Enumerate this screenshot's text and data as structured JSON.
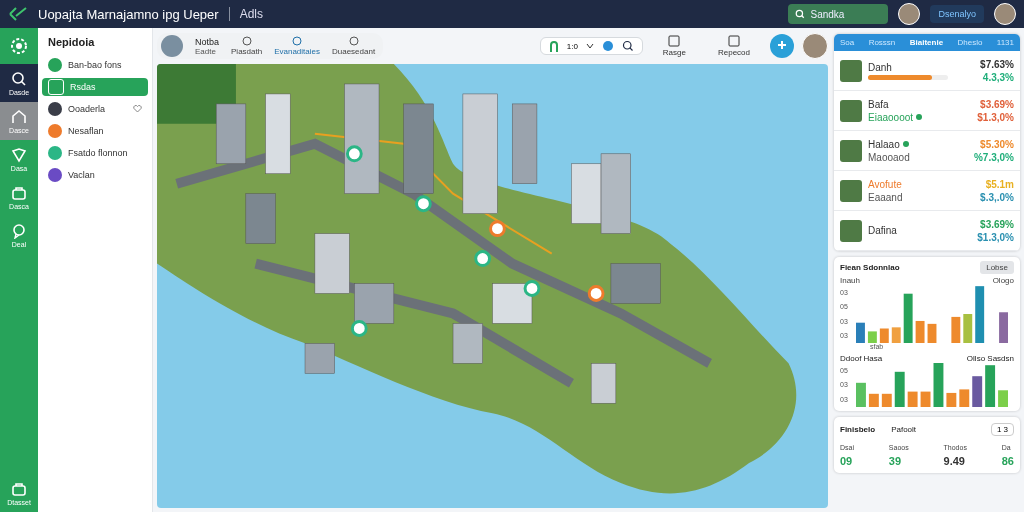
{
  "header": {
    "title": "Uopajta Marnajamno ipg Ueper",
    "subtitle": "Adls",
    "search": {
      "placeholder": "Sandka"
    },
    "user_button": "Dsenalyo"
  },
  "rail": {
    "items": [
      {
        "label": "Dasde",
        "kind": "search",
        "selected": true,
        "highlighted": false
      },
      {
        "label": "Dasce",
        "kind": "home",
        "selected": false,
        "highlighted": true
      },
      {
        "label": "Dasa",
        "kind": "shield",
        "selected": false,
        "highlighted": false
      },
      {
        "label": "Dasca",
        "kind": "bag",
        "selected": false,
        "highlighted": false
      },
      {
        "label": "Deal",
        "kind": "chat",
        "selected": false,
        "highlighted": false
      }
    ],
    "bottom": "Dtasset"
  },
  "sidebar": {
    "heading": "Nepidoia",
    "items": [
      {
        "label": "Ban-bao fons",
        "color": "#27a35a",
        "selected": false,
        "badge": false
      },
      {
        "label": "Rsdas",
        "color": "#27a35a",
        "selected": true,
        "badge": false
      },
      {
        "label": "Ooaderla",
        "color": "#3a3d48",
        "selected": false,
        "badge": true
      },
      {
        "label": "Nesaflan",
        "color": "#ee7b2c",
        "selected": false,
        "badge": false
      },
      {
        "label": "Fsatdo flonnon",
        "color": "#2bb686",
        "selected": false,
        "badge": false
      },
      {
        "label": "Vaclan",
        "color": "#6a4bc4",
        "selected": false,
        "badge": false
      }
    ]
  },
  "toolbar": {
    "profile": {
      "name": "Notba",
      "sub": "Eadte"
    },
    "tabs": [
      {
        "label": "Piasdath",
        "selected": false
      },
      {
        "label": "Evanaditaies",
        "selected": true
      },
      {
        "label": "Duaesedant",
        "selected": false
      }
    ],
    "control_value": "1:0",
    "actions": [
      {
        "label": "Rasge"
      },
      {
        "label": "Repecod"
      }
    ]
  },
  "panel": {
    "tabs": [
      {
        "label": "Soa",
        "selected": false
      },
      {
        "label": "Rosssn",
        "selected": false
      },
      {
        "label": "Biaitenie",
        "selected": true
      },
      {
        "label": "Dheslo",
        "selected": false
      },
      {
        "label": "1131",
        "selected": false
      }
    ],
    "rows": [
      {
        "name": {
          "text": "Danh",
          "color": "#333333"
        },
        "sub": null,
        "dot": false,
        "level": 0.8,
        "value": {
          "text": "$7.63%",
          "color": "#333333"
        },
        "change": {
          "text": "4.3,3%",
          "color": "#1fae7a"
        }
      },
      {
        "name": {
          "text": "Bafa",
          "color": "#333333"
        },
        "sub": {
          "text": "Eiaaoooot",
          "color": "#27a35a"
        },
        "dot": false,
        "sub_dot": true,
        "value": {
          "text": "$3.69%",
          "color": "#e0603a"
        },
        "change": {
          "text": "$1.3,0%",
          "color": "#e0603a"
        }
      },
      {
        "name": {
          "text": "Halaao",
          "color": "#333333"
        },
        "sub": {
          "text": "Maooaod",
          "color": "#555555"
        },
        "dot": true,
        "value": {
          "text": "$5.30%",
          "color": "#ee8a2c"
        },
        "change": {
          "text": "%7.3,0%",
          "color": "#1fae7a"
        }
      },
      {
        "name": {
          "text": "Avofute",
          "color": "#ee7b2c"
        },
        "sub": {
          "text": "Eaaand",
          "color": "#555555"
        },
        "dot": false,
        "value": {
          "text": "$5.1m",
          "color": "#e8b020"
        },
        "change": {
          "text": "$.3,.0%",
          "color": "#2a90b0"
        }
      },
      {
        "name": {
          "text": "Dafina",
          "color": "#333333"
        },
        "sub": null,
        "dot": false,
        "value": {
          "text": "$3.69%",
          "color": "#27a35a"
        },
        "change": {
          "text": "$1.3,0%",
          "color": "#2a90b0"
        }
      }
    ]
  },
  "charts_card": {
    "title": "Fiean Sdonnlao",
    "button": "Lobse",
    "chart_1": {
      "left_label": "Inauh",
      "right_label": "Ologo",
      "y_labels": [
        "03",
        "05",
        "03",
        "03"
      ],
      "x_label": "sfab"
    },
    "chart_2": {
      "left_label": "Ddoof Hasa",
      "right_label": "Ollso Sasdsn",
      "y_labels": [
        "05",
        "03",
        "03"
      ]
    }
  },
  "stats_card": {
    "title": "Finisbelo",
    "subtitle": "Pafoolt",
    "button": "1 3",
    "stats": [
      {
        "label": "Dsai",
        "value": "09",
        "color": "#27a35a"
      },
      {
        "label": "Saoos",
        "value": "39",
        "color": "#27a35a"
      },
      {
        "label": "Thodos",
        "value": "9.49",
        "color": "#333333"
      },
      {
        "label": "Da",
        "value": "86",
        "color": "#27a35a"
      }
    ]
  }
}
